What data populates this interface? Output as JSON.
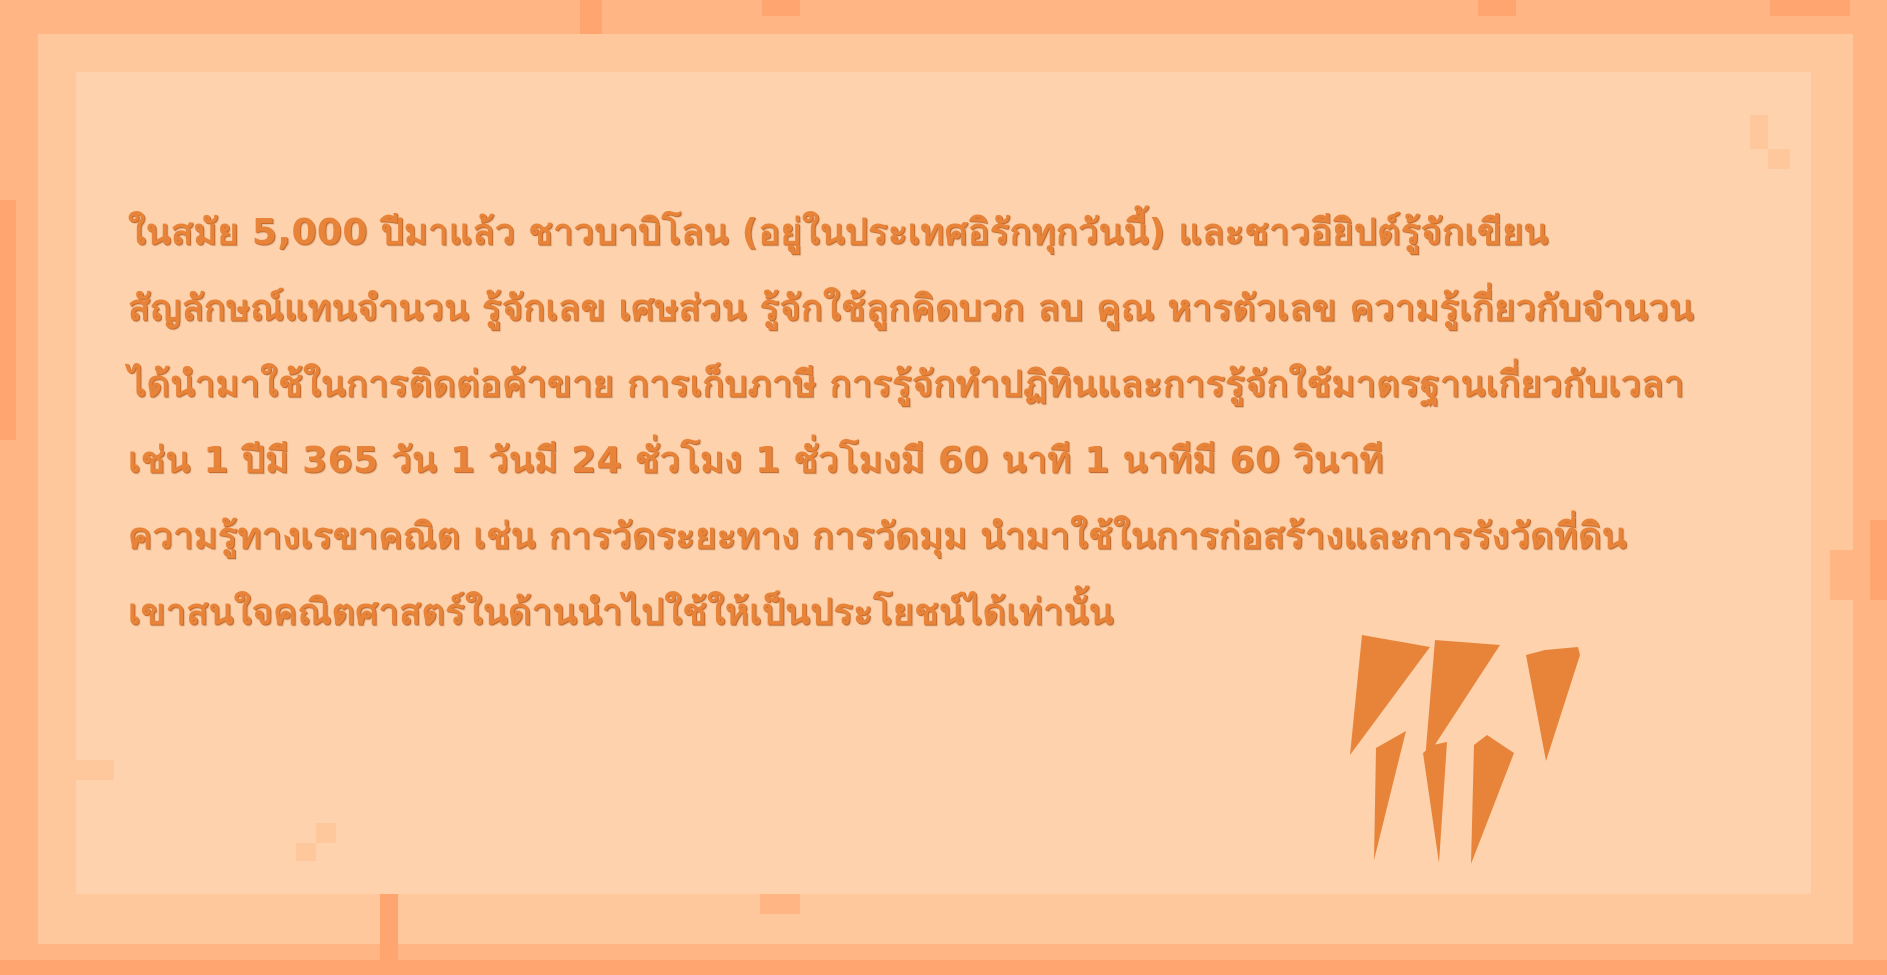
{
  "colors": {
    "outer_frame": "#ffb684",
    "mid_frame": "#ffc89c",
    "paper": "#fdd2ac",
    "text": "#e8843a",
    "accent": "#e8843a"
  },
  "content": {
    "lines": [
      "ในสมัย 5,000  ปีมาแล้ว ชาวบาบิโลน (อยู่ในประเทศอิรักทุกวันนี้) และชาวอียิปต์รู้จักเขียน",
      "สัญลักษณ์แทนจำนวน รู้จักเลข เศษส่วน รู้จักใช้ลูกคิดบวก ลบ คูณ หารตัวเลข ความรู้เกี่ยวกับจำนวน",
      "ได้นำมาใช้ในการติดต่อค้าขาย การเก็บภาษี การรู้จักทำปฏิทินและการรู้จักใช้มาตรฐานเกี่ยวกับเวลา",
      "เช่น 1 ปีมี 365 วัน 1 วันมี 24 ชั่วโมง 1 ชั่วโมงมี 60 นาที  1 นาทีมี 60 วินาที",
      "ความรู้ทางเรขาคณิต เช่น การวัดระยะทาง การวัดมุม นำมาใช้ในการก่อสร้างและการรังวัดที่ดิน",
      "เขาสนใจคณิตศาสตร์ในด้านนำไปใช้ให้เป็นประโยชน์ได้เท่านั้น"
    ]
  },
  "decoration": {
    "icon": "claw-scratch-icon"
  }
}
